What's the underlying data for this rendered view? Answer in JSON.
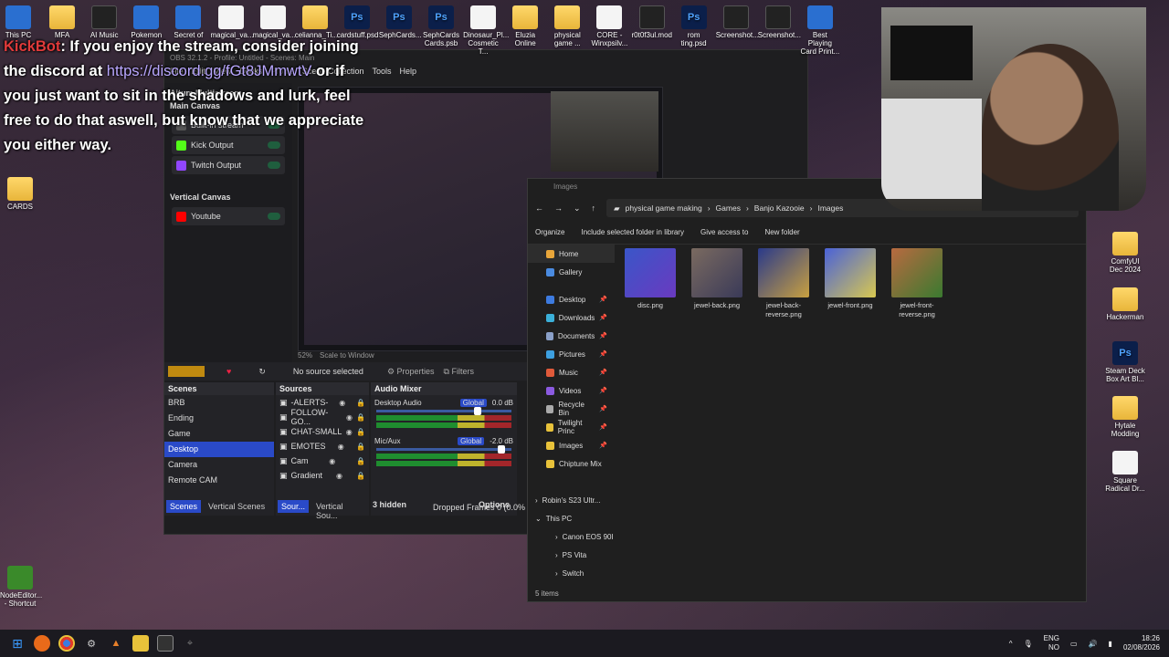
{
  "desktop_top_icons": [
    {
      "label": "This PC",
      "type": "app"
    },
    {
      "label": "MFA",
      "type": "folder"
    },
    {
      "label": "AI Music",
      "type": "dark"
    },
    {
      "label": "Pokemon",
      "type": "app"
    },
    {
      "label": "Secret of",
      "type": "app"
    },
    {
      "label": "magical_va...",
      "type": "file"
    },
    {
      "label": "magical_va...",
      "type": "file"
    },
    {
      "label": "celianna_Ti...",
      "type": "folder"
    },
    {
      "label": "cardstuff.psd",
      "type": "ps"
    },
    {
      "label": "SephCards...",
      "type": "ps"
    },
    {
      "label": "SephCards Cards.psb",
      "type": "ps"
    },
    {
      "label": "Dinosaur_Pl... Cosmetic T...",
      "type": "file"
    },
    {
      "label": "Eluzia Online",
      "type": "folder"
    },
    {
      "label": "physical game ...",
      "type": "folder"
    },
    {
      "label": "CORE - Winxpsilv...",
      "type": "file"
    },
    {
      "label": "r0t0f3ul.mod",
      "type": "dark"
    },
    {
      "label": "rom ting.psd",
      "type": "ps"
    },
    {
      "label": "Screenshot...",
      "type": "dark"
    },
    {
      "label": "Screenshot...",
      "type": "dark"
    },
    {
      "label": "Best Playing Card Print...",
      "type": "app"
    }
  ],
  "desktop_left_icons": [
    {
      "label": "CARDS",
      "type": "folder"
    },
    {
      "label": "NodeEditor... - Shortcut",
      "type": "green"
    }
  ],
  "desktop_right_icons": [
    {
      "label": "ComfyUI Dec 2024",
      "type": "folder"
    },
    {
      "label": "Hackerman",
      "type": "folder"
    },
    {
      "label": "Steam Deck Box Art Bl...",
      "type": "ps"
    },
    {
      "label": "Hytale Modding",
      "type": "folder"
    },
    {
      "label": "Square Radical Dr...",
      "type": "file"
    }
  ],
  "chat": {
    "user": "KickBot",
    "text1": ": If you enjoy the stream, consider joining the discord at ",
    "link": "https://discord.gg/fGt8JMmwtV",
    "text2": " or if you just want to sit in the shadows and lurk, feel free to do that aswell, but know that we appreciate you either way."
  },
  "obs": {
    "title": "OBS 32.1.2 - Profile: Untitled - Scenes: Main",
    "menu": [
      "File",
      "Edit",
      "View",
      "Docks",
      "Profile",
      "Scene Collection",
      "Tools",
      "Help"
    ],
    "canvas_title": "Aitum Multistream",
    "main_canvas": "Main Canvas",
    "main_outputs": [
      "Built-in stream",
      "Kick Output",
      "Twitch Output"
    ],
    "vertical_canvas": "Vertical Canvas",
    "vertical_outputs": [
      "Youtube"
    ],
    "no_source": "No source selected",
    "properties": "Properties",
    "filters": "Filters",
    "zoom": "52%",
    "scale_label": "Scale to Window",
    "scenes_title": "Scenes",
    "scenes": [
      "BRB",
      "Ending",
      "Game",
      "Desktop",
      "Camera",
      "Remote CAM"
    ],
    "selected_scene": "Desktop",
    "sources_title": "Sources",
    "sources": [
      "-ALERTS-",
      "FOLLOW-GO...",
      "CHAT-SMALL",
      "EMOTES",
      "Cam",
      "Gradient"
    ],
    "mixer_title": "Audio Mixer",
    "mixer": [
      {
        "name": "Desktop Audio",
        "mode": "Global",
        "db": "0.0 dB",
        "level": 0.72
      },
      {
        "name": "Mic/Aux",
        "mode": "Global",
        "db": "-2.0 dB",
        "level": 0.9
      }
    ],
    "hidden": "3 hidden",
    "options": "Options",
    "dropped": "Dropped Frames 0 (0.0%",
    "scene_tabs": [
      "Scenes",
      "Vertical Scenes"
    ],
    "source_tabs": [
      "Sour...",
      "Vertical Sou..."
    ]
  },
  "explorer": {
    "title": "Images",
    "path": [
      "physical game making",
      "Games",
      "Banjo Kazooie",
      "Images"
    ],
    "tools": [
      "Organize",
      "Include selected folder in library",
      "Give access to",
      "New folder"
    ],
    "nav": [
      {
        "label": "Home",
        "color": "#e8a63a",
        "pinned": false
      },
      {
        "label": "Gallery",
        "color": "#4a8be0",
        "pinned": false
      },
      {
        "label": "Desktop",
        "color": "#3d7be0",
        "pinned": true
      },
      {
        "label": "Downloads",
        "color": "#3bb0d9",
        "pinned": true
      },
      {
        "label": "Documents",
        "color": "#8aa0c8",
        "pinned": true
      },
      {
        "label": "Pictures",
        "color": "#3da0e0",
        "pinned": true
      },
      {
        "label": "Music",
        "color": "#e05a3a",
        "pinned": true
      },
      {
        "label": "Videos",
        "color": "#8b5ae0",
        "pinned": true
      },
      {
        "label": "Recycle Bin",
        "color": "#aaa",
        "pinned": true
      },
      {
        "label": "Twilight Princ",
        "color": "#e8c23a",
        "pinned": true
      },
      {
        "label": "Images",
        "color": "#e8c23a",
        "pinned": true
      },
      {
        "label": "Chiptune Mix",
        "color": "#e8c23a",
        "pinned": false
      }
    ],
    "tree": [
      "Robin's S23 Ultr...",
      "This PC",
      "Canon EOS 90I",
      "PS Vita",
      "Switch"
    ],
    "files": [
      {
        "name": "disc.png",
        "color1": "#3a56c8",
        "color2": "#6a3ac0"
      },
      {
        "name": "jewel-back.png",
        "color1": "#7a6a60",
        "color2": "#3a3a58"
      },
      {
        "name": "jewel-back-reverse.png",
        "color1": "#2a3a8a",
        "color2": "#c8a040"
      },
      {
        "name": "jewel-front.png",
        "color1": "#4a62d8",
        "color2": "#d8c850"
      },
      {
        "name": "jewel-front-reverse.png",
        "color1": "#b86a40",
        "color2": "#3a7a30"
      }
    ],
    "status": "5 items"
  },
  "taskbar": {
    "lang": "ENG",
    "region": "NO",
    "time": "18:26",
    "date": "02/08/2026"
  }
}
